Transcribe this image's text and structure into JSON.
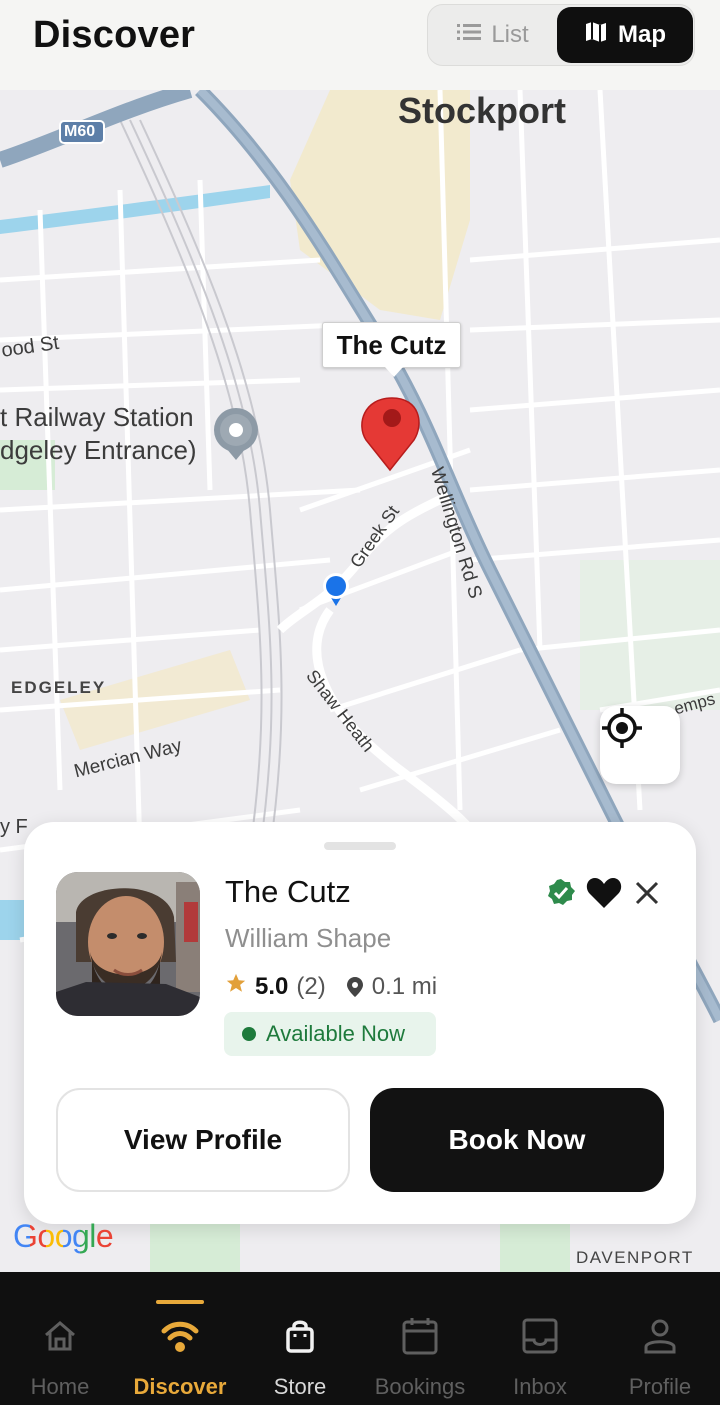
{
  "header": {
    "title": "Discover",
    "view_toggle": {
      "list_label": "List",
      "map_label": "Map",
      "selected": "Map"
    }
  },
  "map": {
    "labels": {
      "city": "Stockport",
      "motorway": "M60",
      "street_wood": "ood St",
      "station_line1": "t Railway Station",
      "station_line2": "dgeley Entrance)",
      "greek": "Greek St",
      "wellington": "Wellington Rd S",
      "edgeley": "EDGELEY",
      "mercian": "Mercian Way",
      "shaw": "Shaw Heath",
      "hemps": "emps",
      "y_fc": "y F",
      "davenport": "DAVENPORT"
    },
    "pin_callout": "The Cutz",
    "attribution": "Google"
  },
  "card": {
    "name": "The Cutz",
    "owner": "William Shape",
    "rating": "5.0",
    "review_count": "(2)",
    "distance": "0.1 mi",
    "availability": "Available Now",
    "verified_icon": "verified-badge-icon",
    "favorite_icon": "heart-icon",
    "close_icon": "close-icon",
    "view_profile_label": "View Profile",
    "book_now_label": "Book Now"
  },
  "nav": {
    "items": [
      {
        "label": "Home",
        "icon": "home-icon"
      },
      {
        "label": "Discover",
        "icon": "discover-icon"
      },
      {
        "label": "Store",
        "icon": "bag-icon"
      },
      {
        "label": "Bookings",
        "icon": "calendar-icon"
      },
      {
        "label": "Inbox",
        "icon": "inbox-icon"
      },
      {
        "label": "Profile",
        "icon": "person-icon"
      }
    ],
    "active": "Discover"
  },
  "colors": {
    "accent": "#e8a93a",
    "available_green": "#1e7a3c",
    "pin_red": "#e53935",
    "dark": "#121212"
  }
}
